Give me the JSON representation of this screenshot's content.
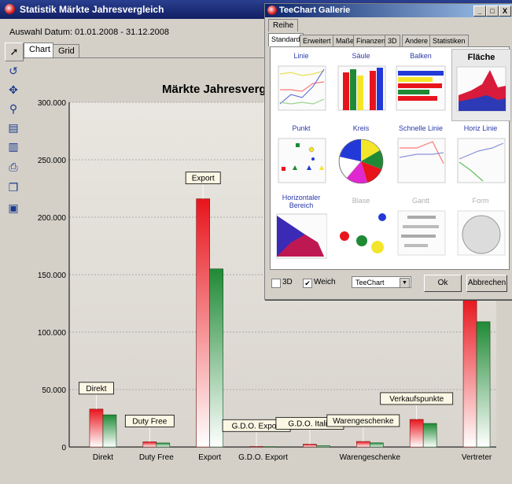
{
  "app": {
    "title": "Statistik Märkte Jahresvergleich",
    "date_label": "Auswahl Datum: 01.01.2008 - 31.12.2008"
  },
  "toolbar": {
    "tools": [
      "pointer-icon",
      "rotate-icon",
      "move-icon",
      "zoom-icon",
      "edit-icon",
      "export-icon",
      "print-icon",
      "copy-icon",
      "save-icon"
    ]
  },
  "tabs": {
    "chart": "Chart",
    "grid": "Grid"
  },
  "chart_data": {
    "type": "bar",
    "title": "Märkte Jahresvergl",
    "ylim": [
      0,
      300000
    ],
    "yticks": [
      "0",
      "50.000",
      "100.000",
      "150.000",
      "200.000",
      "250.000",
      "300.000"
    ],
    "categories": [
      "Direkt",
      "Duty Free",
      "Export",
      "G.D.O. Export",
      "G.D.O. Italia",
      "Warengeschenke",
      "Verkaufspunkte",
      "Vertreter"
    ],
    "axis_labels": [
      "Direkt",
      "Duty Free",
      "Export",
      "G.D.O. Export",
      "",
      "Warengeschenke",
      "",
      "Vertreter"
    ],
    "mark_labels": [
      "Direkt",
      "Duty Free",
      "Export",
      "G.D.O. Export",
      "G.D.O. Italia",
      "Warengeschenke",
      "Verkaufspunkte",
      ""
    ],
    "series": [
      {
        "color": "#e8141c",
        "values": [
          33000,
          4500,
          216000,
          500,
          2500,
          4800,
          24000,
          130000
        ]
      },
      {
        "color": "#1f8a35",
        "values": [
          28000,
          3500,
          155000,
          300,
          1200,
          3600,
          20500,
          109000
        ]
      }
    ],
    "grid": true
  },
  "gallery": {
    "title": "TeeChart Gallerie",
    "window_buttons": [
      "_",
      "□",
      "X"
    ],
    "reihe_tab": "Reihe",
    "subtabs": [
      "Standard",
      "Erweitert",
      "Maße",
      "Finanzen",
      "3D",
      "Andere",
      "Statistiken"
    ],
    "types": [
      "Linie",
      "Säule",
      "Balken",
      "Fläche",
      "Punkt",
      "Kreis",
      "Schnelle Linie",
      "Horiz Linie",
      "Horizontaler Bereich",
      "Blase",
      "Gantt",
      "Form"
    ],
    "check_3d": "3D",
    "check_weich": "Weich",
    "theme_select": "TeeChart",
    "ok": "Ok",
    "cancel": "Abbrechen"
  }
}
